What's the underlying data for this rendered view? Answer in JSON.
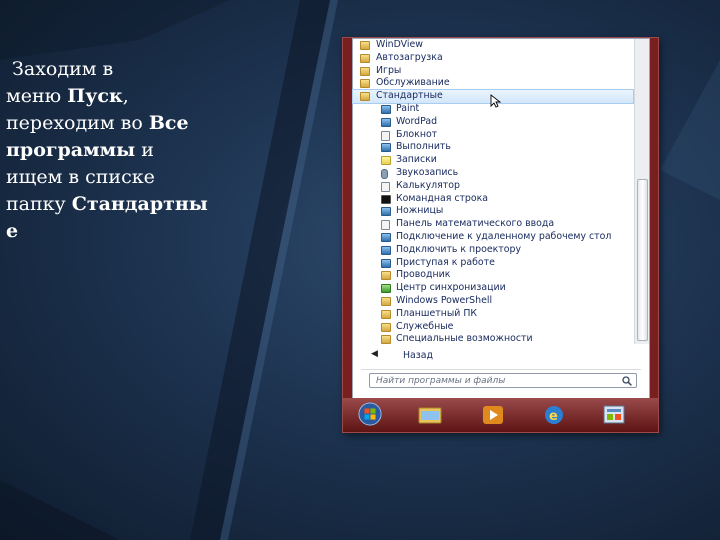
{
  "slide": {
    "line1": "Заходим в",
    "line2_pre": "меню ",
    "line2_bold": "Пуск",
    "line2_post": ",",
    "line3_pre": "переходим во ",
    "line3_bold": "Все",
    "line4_bold": "программы",
    "line4_post": " и",
    "line5": "ищем в списке",
    "line6_pre": "папку ",
    "line6_bold": "Стандартны",
    "line7_bold": "е"
  },
  "menu": {
    "items": [
      {
        "label": "WinDView",
        "icon": "folder-icon"
      },
      {
        "label": "Автозагрузка",
        "icon": "folder-icon"
      },
      {
        "label": "Игры",
        "icon": "folder-icon"
      },
      {
        "label": "Обслуживание",
        "icon": "folder-icon"
      },
      {
        "label": "Стандартные",
        "icon": "folder-icon"
      },
      {
        "label": "Paint",
        "icon": "paint-icon"
      },
      {
        "label": "WordPad",
        "icon": "wordpad-icon"
      },
      {
        "label": "Блокнот",
        "icon": "notepad-icon"
      },
      {
        "label": "Выполнить",
        "icon": "run-icon"
      },
      {
        "label": "Записки",
        "icon": "sticky-notes-icon"
      },
      {
        "label": "Звукозапись",
        "icon": "microphone-icon"
      },
      {
        "label": "Калькулятор",
        "icon": "calculator-icon"
      },
      {
        "label": "Командная строка",
        "icon": "command-prompt-icon"
      },
      {
        "label": "Ножницы",
        "icon": "scissors-icon"
      },
      {
        "label": "Панель математического ввода",
        "icon": "math-input-icon"
      },
      {
        "label": "Подключение к удаленному рабочему стол",
        "icon": "remote-desktop-icon"
      },
      {
        "label": "Подключить к проектору",
        "icon": "projector-icon"
      },
      {
        "label": "Приступая к работе",
        "icon": "getting-started-icon"
      },
      {
        "label": "Проводник",
        "icon": "explorer-icon"
      },
      {
        "label": "Центр синхронизации",
        "icon": "sync-center-icon"
      },
      {
        "label": "Windows PowerShell",
        "icon": "folder-icon"
      },
      {
        "label": "Планшетный ПК",
        "icon": "folder-icon"
      },
      {
        "label": "Служебные",
        "icon": "folder-icon"
      },
      {
        "label": "Специальные возможности",
        "icon": "folder-icon"
      }
    ],
    "back_label": "Назад",
    "search_placeholder": "Найти программы и файлы"
  }
}
